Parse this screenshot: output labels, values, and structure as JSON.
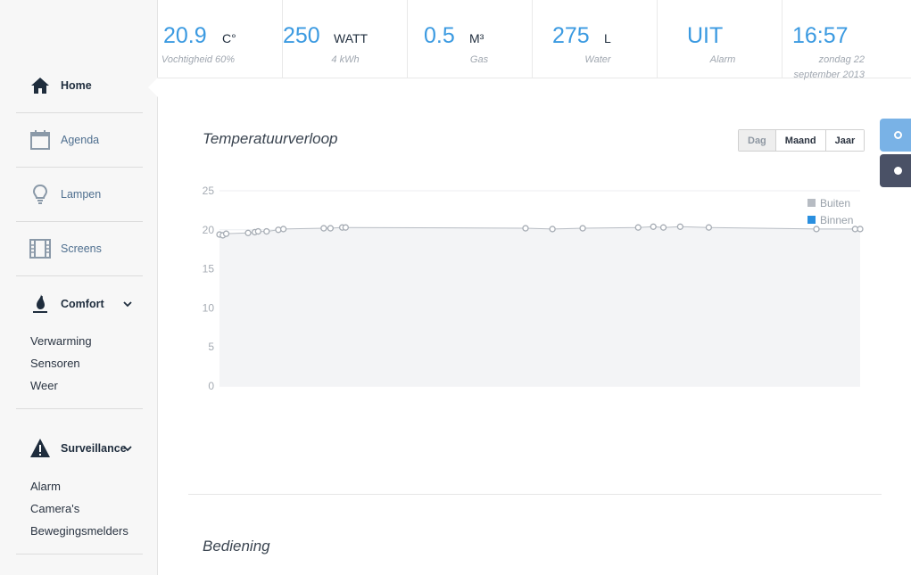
{
  "header": {
    "stats": [
      {
        "value": "20.9",
        "unit": "C°",
        "sub": "Vochtigheid 60%"
      },
      {
        "value": "250",
        "unit": "WATT",
        "sub": "4 kWh"
      },
      {
        "value": "0.5",
        "unit": "M³",
        "sub": "Gas"
      },
      {
        "value": "275",
        "unit": "L",
        "sub": "Water"
      },
      {
        "value": "UIT",
        "unit": "",
        "sub": "Alarm"
      },
      {
        "value": "16:57",
        "unit": "",
        "sub": "zondag 22 september 2013"
      }
    ]
  },
  "sidebar": {
    "items": [
      {
        "label": "Home",
        "icon": "home-icon",
        "active": true
      },
      {
        "label": "Agenda",
        "icon": "calendar-icon"
      },
      {
        "label": "Lampen",
        "icon": "lightbulb-icon"
      },
      {
        "label": "Screens",
        "icon": "film-icon"
      }
    ],
    "comfort": {
      "label": "Comfort",
      "icon": "flame-icon",
      "subitems": [
        "Verwarming",
        "Sensoren",
        "Weer"
      ]
    },
    "surveillance": {
      "label": "Surveillance",
      "icon": "warning-icon",
      "subitems": [
        "Alarm",
        "Camera's",
        "Bewegingsmelders"
      ]
    }
  },
  "main": {
    "chart_title": "Temperatuurverloop",
    "range_tabs": [
      "Dag",
      "Maand",
      "Jaar"
    ],
    "selected_range": "Dag",
    "controls_title": "Bediening"
  },
  "colors": {
    "accent": "#3b9ae1",
    "dark": "#4a5166",
    "light_tab": "#79b2e6",
    "buiten": "#b7bcc3",
    "binnen": "#2a8fdf"
  },
  "chart_data": {
    "type": "line",
    "title": "",
    "xlabel": "",
    "ylabel": "",
    "ylim": [
      0,
      25
    ],
    "yticks": [
      0,
      5,
      10,
      15,
      20,
      25
    ],
    "grid": true,
    "legend": "top-right",
    "legend_entries": [
      "Buiten",
      "Binnen"
    ],
    "series": [
      {
        "name": "Buiten",
        "x": [
          0.0,
          0.2,
          0.4,
          1.7,
          2.1,
          2.3,
          2.8,
          3.5,
          3.8,
          6.2,
          6.6,
          7.3,
          7.5,
          18.2,
          19.8,
          21.6,
          24.9,
          25.8,
          26.4,
          27.4,
          29.1,
          35.5,
          37.8,
          38.1
        ],
        "y": [
          19.4,
          19.3,
          19.5,
          19.6,
          19.7,
          19.8,
          19.8,
          20.0,
          20.1,
          20.2,
          20.2,
          20.3,
          20.3,
          20.2,
          20.1,
          20.2,
          20.3,
          20.4,
          20.3,
          20.4,
          20.3,
          20.1,
          20.1,
          20.1
        ]
      }
    ]
  }
}
